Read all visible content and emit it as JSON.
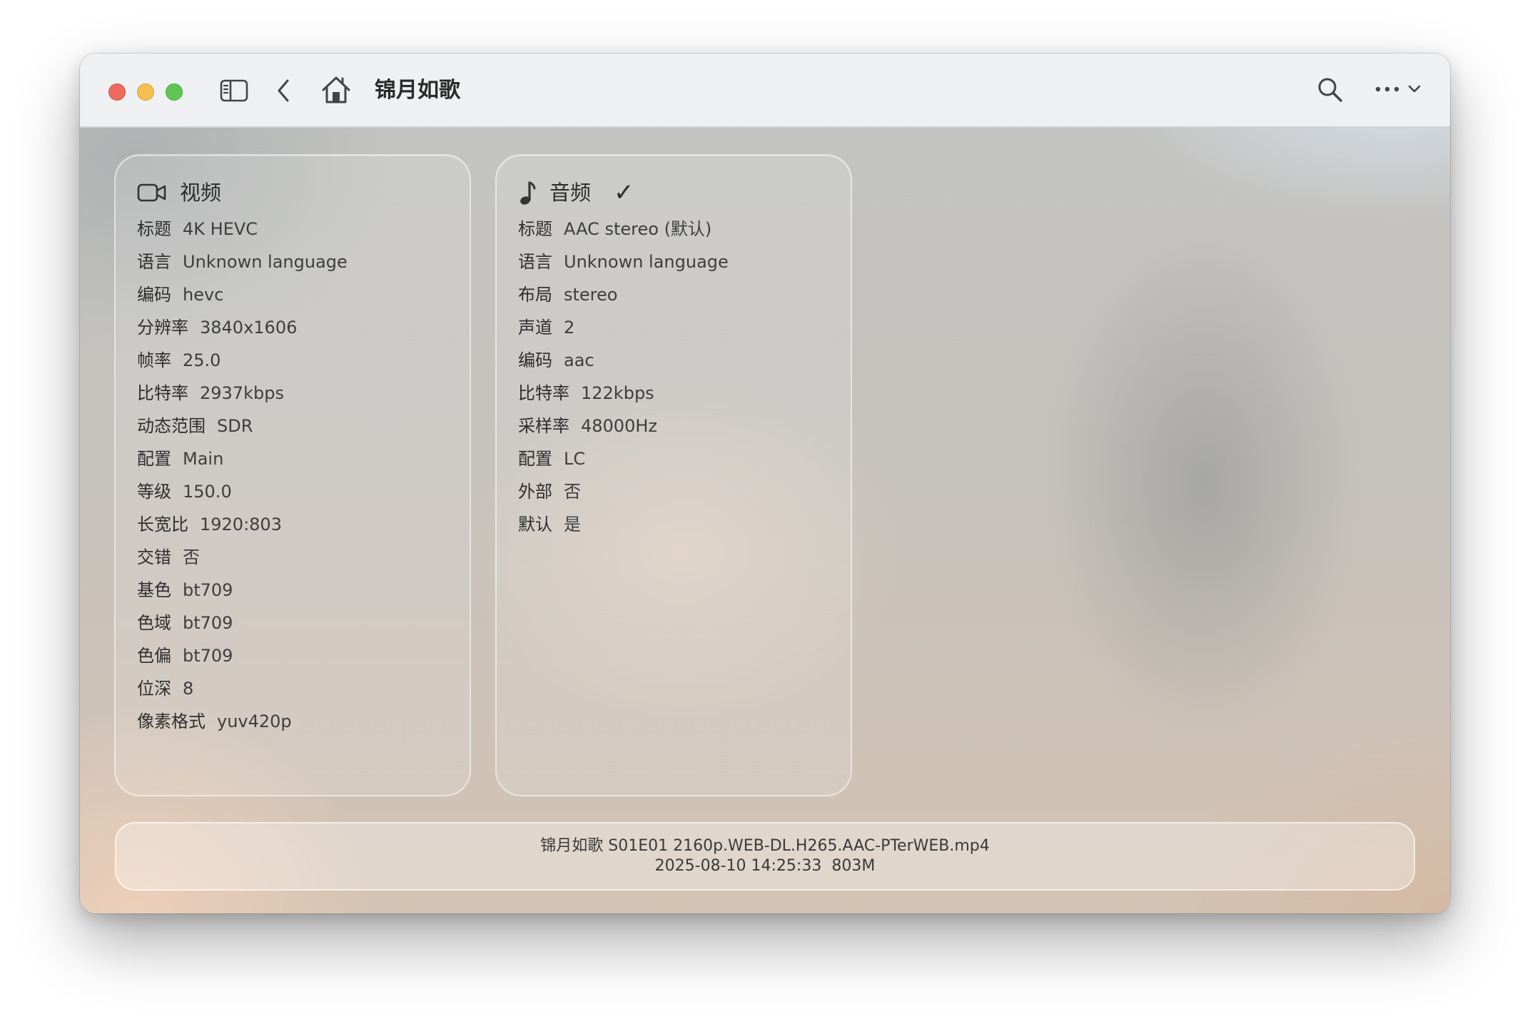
{
  "window": {
    "title": "锦月如歌"
  },
  "toolbar": {
    "icons": [
      "sidebar-toggle-icon",
      "back-chevron-icon",
      "home-icon",
      "search-icon",
      "more-ellipsis-icon",
      "chevron-down-icon"
    ]
  },
  "video": {
    "title": "视频",
    "icon": "video-camera-icon",
    "rows": [
      {
        "label": "标题",
        "value": "4K HEVC"
      },
      {
        "label": "语言",
        "value": "Unknown language"
      },
      {
        "label": "编码",
        "value": "hevc"
      },
      {
        "label": "分辨率",
        "value": "3840x1606"
      },
      {
        "label": "帧率",
        "value": "25.0"
      },
      {
        "label": "比特率",
        "value": "2937kbps"
      },
      {
        "label": "动态范围",
        "value": "SDR"
      },
      {
        "label": "配置",
        "value": "Main"
      },
      {
        "label": "等级",
        "value": "150.0"
      },
      {
        "label": "长宽比",
        "value": "1920:803"
      },
      {
        "label": "交错",
        "value": "否"
      },
      {
        "label": "基色",
        "value": "bt709"
      },
      {
        "label": "色域",
        "value": "bt709"
      },
      {
        "label": "色偏",
        "value": "bt709"
      },
      {
        "label": "位深",
        "value": "8"
      },
      {
        "label": "像素格式",
        "value": "yuv420p"
      }
    ]
  },
  "audio": {
    "title": "音频",
    "icon": "music-note-icon",
    "check": "✓",
    "rows": [
      {
        "label": "标题",
        "value": "AAC stereo (默认)"
      },
      {
        "label": "语言",
        "value": "Unknown language"
      },
      {
        "label": "布局",
        "value": "stereo"
      },
      {
        "label": "声道",
        "value": "2"
      },
      {
        "label": "编码",
        "value": "aac"
      },
      {
        "label": "比特率",
        "value": "122kbps"
      },
      {
        "label": "采样率",
        "value": "48000Hz"
      },
      {
        "label": "配置",
        "value": "LC"
      },
      {
        "label": "外部",
        "value": "否"
      },
      {
        "label": "默认",
        "value": "是"
      }
    ]
  },
  "file": {
    "name": "锦月如歌 S01E01 2160p.WEB-DL.H265.AAC-PTerWEB.mp4",
    "date": "2025-08-10 14:25:33",
    "size": "803M"
  },
  "colors": {
    "close": "#ed6a5e",
    "minimize": "#f5bf4f",
    "maximize": "#61c554"
  }
}
